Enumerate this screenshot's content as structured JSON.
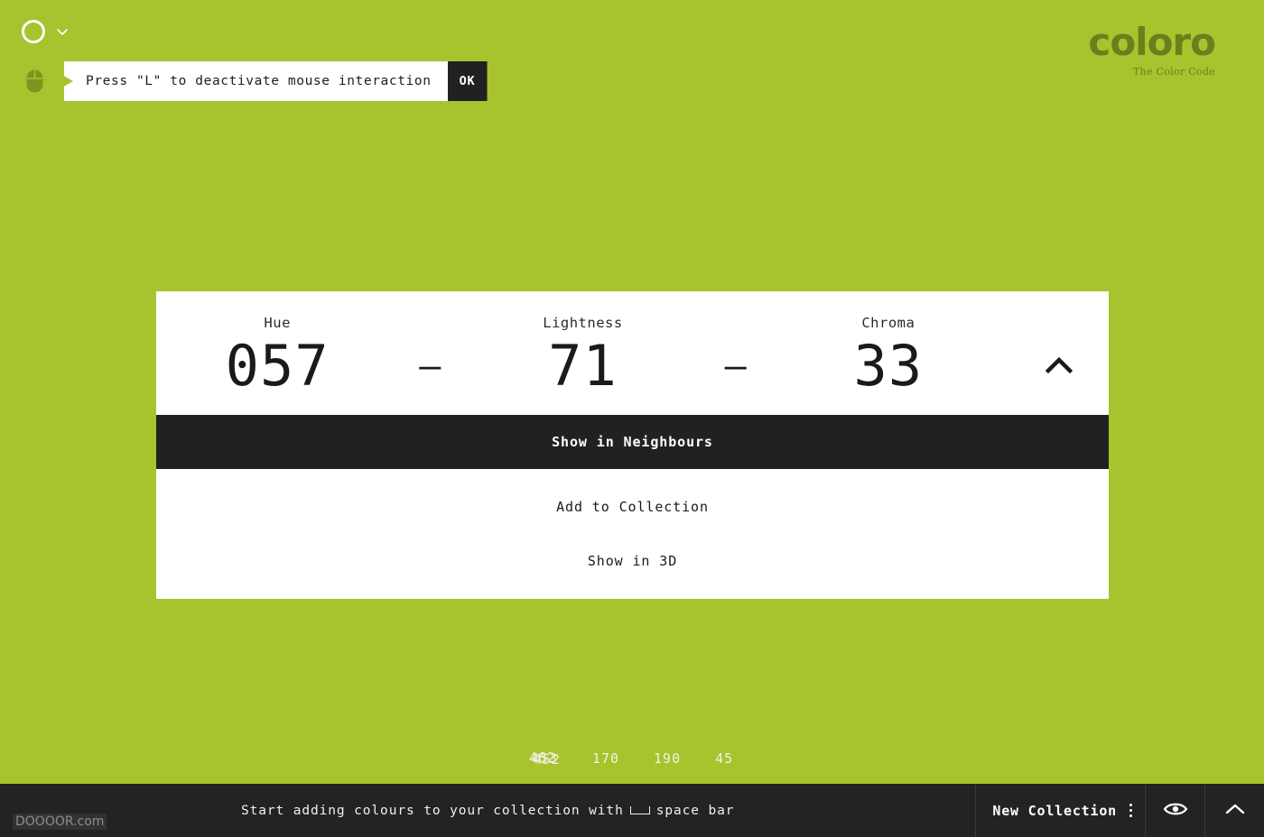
{
  "theme": {
    "background": "#a7c32e",
    "card_background": "#ffffff",
    "dark": "#212121",
    "bottom_bar": "#232323",
    "logo_color": "#6d7f1c"
  },
  "topbar": {
    "circle_icon": "circle-outline-icon",
    "chevron_icon": "chevron-down-icon"
  },
  "tooltip": {
    "mouse_icon": "mouse-icon",
    "message": "Press \"L\" to deactivate mouse interaction",
    "ok_label": "OK"
  },
  "logo": {
    "wordmark": "coloro",
    "tagline": "The Color Code"
  },
  "color_card": {
    "columns": [
      {
        "label": "Hue",
        "value": "057"
      },
      {
        "label": "Lightness",
        "value": "71"
      },
      {
        "label": "Chroma",
        "value": "33"
      }
    ],
    "separator": "–",
    "collapse_icon": "chevron-up-icon",
    "menu": [
      {
        "label": "Show in Neighbours",
        "active": true
      },
      {
        "label": "Add to Collection",
        "active": false
      },
      {
        "label": "Show in 3D",
        "active": false
      }
    ]
  },
  "mini_readout": {
    "glitched": [
      "453",
      "452",
      "462"
    ],
    "values": [
      "170",
      "190",
      "45"
    ]
  },
  "bottom_bar": {
    "hint_before": "Start adding colours to your collection with",
    "hint_key": "space-bar-key",
    "hint_after": "space bar",
    "collection_label": "New Collection",
    "menu_icon": "vertical-dots-icon",
    "visibility_icon": "eye-icon",
    "expand_icon": "chevron-up-icon"
  },
  "watermark": {
    "text": "DOOOOR.com"
  }
}
